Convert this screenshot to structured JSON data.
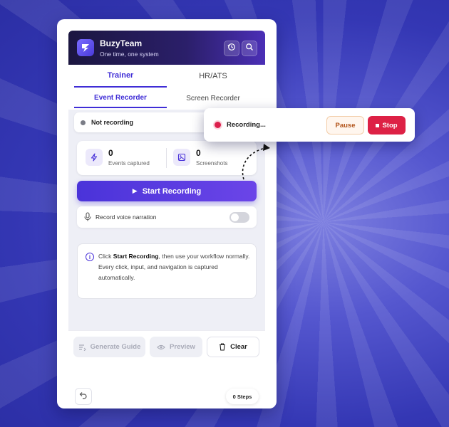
{
  "colors": {
    "accent": "#4a33d9",
    "record_red": "#dd2145",
    "pause_orange": "#b2541a"
  },
  "header": {
    "brand": "BuzyTeam",
    "tagline": "One time, one system",
    "logo_icon": "bolt-logo",
    "buttons": [
      "history-icon",
      "search-icon"
    ]
  },
  "tabs": {
    "primary": [
      {
        "label": "Trainer",
        "active": true
      },
      {
        "label": "HR/ATS",
        "active": false
      }
    ],
    "secondary": [
      {
        "label": "Event Recorder",
        "active": true
      },
      {
        "label": "Screen Recorder",
        "active": false
      }
    ]
  },
  "status": {
    "text": "Not recording"
  },
  "stats": {
    "events": {
      "value": "0",
      "label": "Events captured"
    },
    "screenshots": {
      "value": "0",
      "label": "Screenshots"
    }
  },
  "start_button": {
    "label": "Start Recording"
  },
  "voice": {
    "label": "Record voice narration",
    "enabled": false
  },
  "info": {
    "prefix": "Click ",
    "bold": "Start Recording",
    "suffix": ", then use your workflow normally.",
    "line2": "Every click, input, and navigation is captured automatically."
  },
  "footer": {
    "generate_label": "Generate Guide",
    "preview_label": "Preview",
    "clear_label": "Clear",
    "steps_label": "0 Steps"
  },
  "recording_popup": {
    "text": "Recording...",
    "pause_label": "Pause",
    "stop_label": "Stop"
  }
}
